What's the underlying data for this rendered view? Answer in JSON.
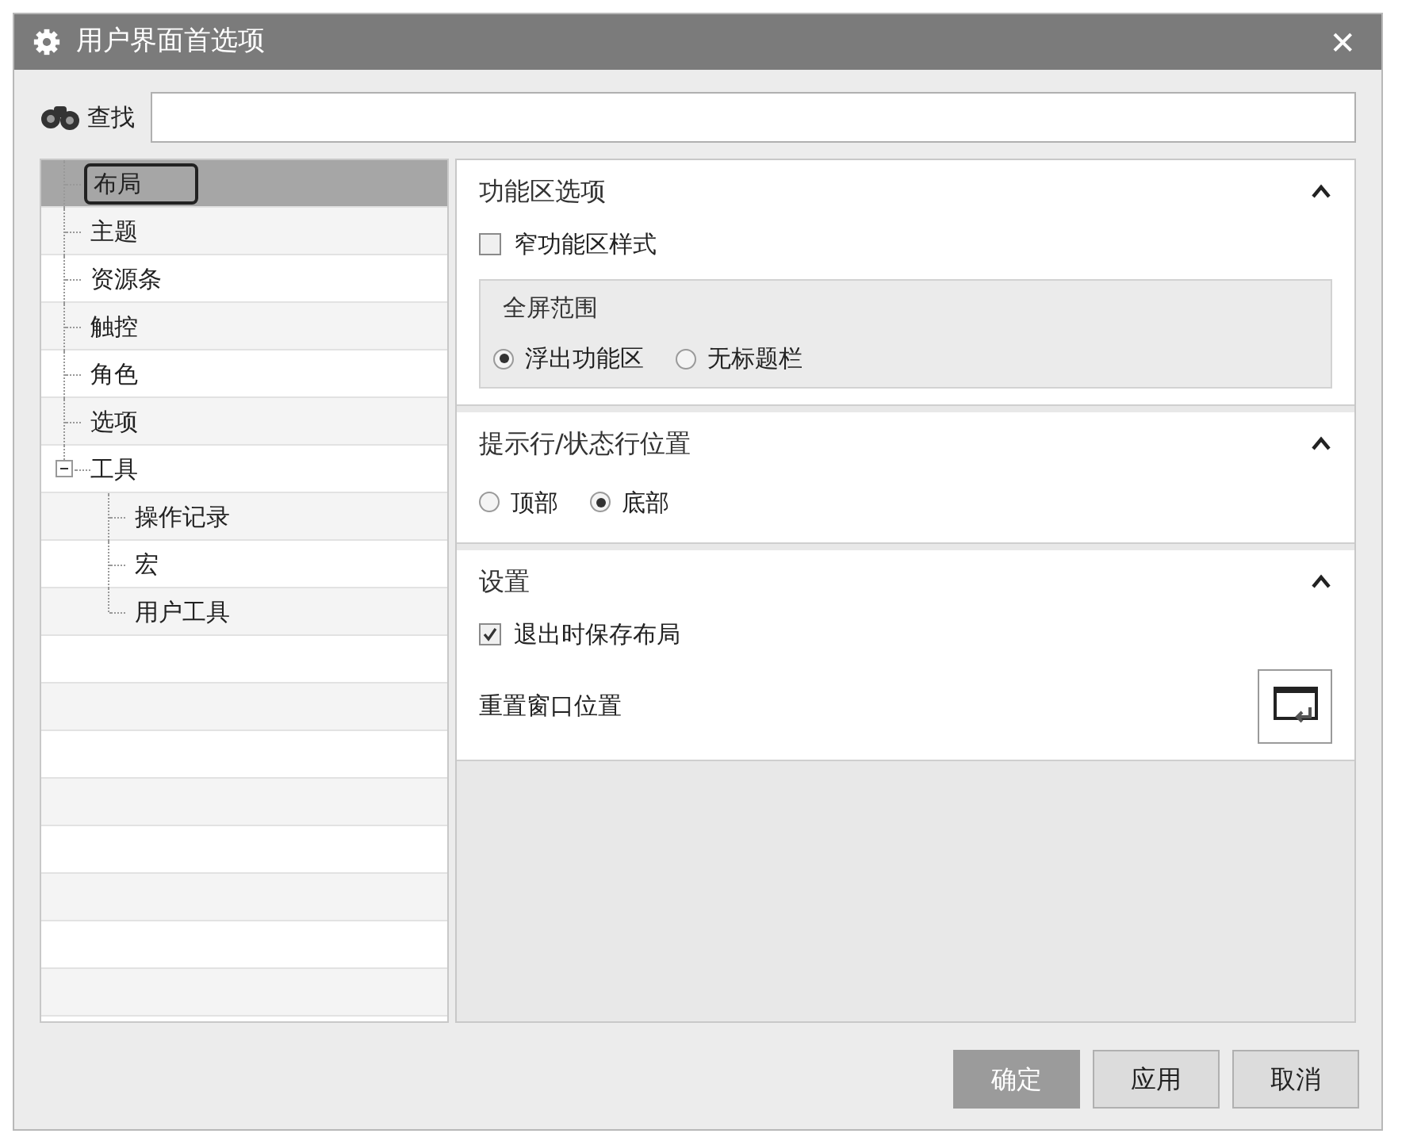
{
  "window": {
    "title": "用户界面首选项",
    "close": "✕"
  },
  "search": {
    "label": "查找"
  },
  "tree": [
    {
      "label": "布局",
      "selected": true
    },
    {
      "label": "主题",
      "selected": false
    },
    {
      "label": "资源条",
      "selected": false
    },
    {
      "label": "触控",
      "selected": false
    },
    {
      "label": "角色",
      "selected": false
    },
    {
      "label": "选项",
      "selected": false
    },
    {
      "label": "工具",
      "selected": false,
      "expanded": true,
      "children": [
        {
          "label": "操作记录",
          "selected": false
        },
        {
          "label": "宏",
          "selected": false
        },
        {
          "label": "用户工具",
          "selected": false
        }
      ]
    }
  ],
  "sections": [
    {
      "title": "功能区选项",
      "expanded": true,
      "items": [
        {
          "kind": "checkbox",
          "label": "窄功能区样式",
          "checked": false
        },
        {
          "kind": "group",
          "label": "全屏范围",
          "options": [
            {
              "label": "浮出功能区",
              "selected": true
            },
            {
              "label": "无标题栏",
              "selected": false
            }
          ]
        }
      ]
    },
    {
      "title": "提示行/状态行位置",
      "expanded": true,
      "items": [
        {
          "kind": "radios",
          "options": [
            {
              "label": "顶部",
              "selected": false
            },
            {
              "label": "底部",
              "selected": true
            }
          ]
        }
      ]
    },
    {
      "title": "设置",
      "expanded": true,
      "items": [
        {
          "kind": "checkbox",
          "label": "退出时保存布局",
          "checked": true
        },
        {
          "kind": "action",
          "label": "重置窗口位置"
        }
      ]
    }
  ],
  "buttons": [
    {
      "label": "确定",
      "default": true
    },
    {
      "label": "应用",
      "default": false
    },
    {
      "label": "取消",
      "default": false
    }
  ]
}
